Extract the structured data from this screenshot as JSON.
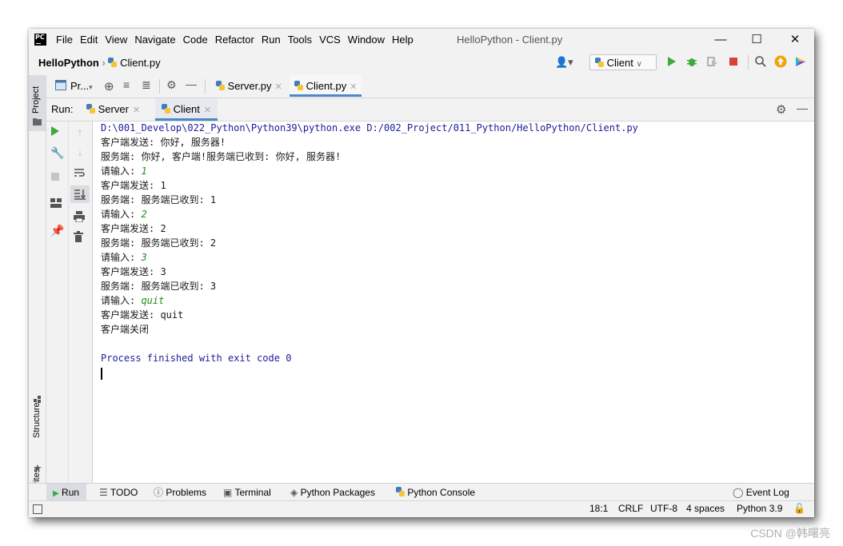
{
  "app": {
    "logo_text": "PC",
    "window_title": "HelloPython - Client.py"
  },
  "menu": [
    "File",
    "Edit",
    "View",
    "Navigate",
    "Code",
    "Refactor",
    "Run",
    "Tools",
    "VCS",
    "Window",
    "Help"
  ],
  "navbar": {
    "project": "HelloPython",
    "file": "Client.py",
    "run_config": "Client"
  },
  "side_tabs": {
    "project": "Project",
    "structure": "Structure",
    "favorites": "Favorites"
  },
  "editor": {
    "project_view_label": "Pr...",
    "tabs": [
      "Server.py",
      "Client.py"
    ],
    "active_tab": "Client.py"
  },
  "run_panel": {
    "label": "Run:",
    "tabs": [
      "Server",
      "Client"
    ],
    "active_tab": "Client"
  },
  "console": {
    "lines": [
      {
        "text": "D:\\001_Develop\\022_Python\\Python39\\python.exe D:/002_Project/011_Python/HelloPython/Client.py",
        "style": "blue"
      },
      {
        "prefix": "客户端发送: 你好, 服务器!"
      },
      {
        "prefix": "服务端: 你好, 客户端!服务端已收到: 你好, 服务器!"
      },
      {
        "prefix": "请输入: ",
        "input": "1"
      },
      {
        "prefix": "客户端发送: 1"
      },
      {
        "prefix": "服务端: 服务端已收到: 1"
      },
      {
        "prefix": "请输入: ",
        "input": "2"
      },
      {
        "prefix": "客户端发送: 2"
      },
      {
        "prefix": "服务端: 服务端已收到: 2"
      },
      {
        "prefix": "请输入: ",
        "input": "3"
      },
      {
        "prefix": "客户端发送: 3"
      },
      {
        "prefix": "服务端: 服务端已收到: 3"
      },
      {
        "prefix": "请输入: ",
        "input": "quit"
      },
      {
        "prefix": "客户端发送: quit"
      },
      {
        "prefix": "客户端关闭"
      },
      {
        "prefix": ""
      },
      {
        "text": "Process finished with exit code 0",
        "style": "blue"
      }
    ]
  },
  "bottom_tools": [
    "Run",
    "TODO",
    "Problems",
    "Terminal",
    "Python Packages",
    "Python Console",
    "Event Log"
  ],
  "status": {
    "position": "18:1",
    "line_sep": "CRLF",
    "encoding": "UTF-8",
    "indent": "4 spaces",
    "interpreter": "Python 3.9"
  },
  "watermark": "CSDN @韩曙亮",
  "colors": {
    "accent": "#4a88c7",
    "console_blue": "#1d1d9a",
    "console_input": "#1f8a1f",
    "run_green": "#3daa3d",
    "stop_red": "#d94040"
  }
}
